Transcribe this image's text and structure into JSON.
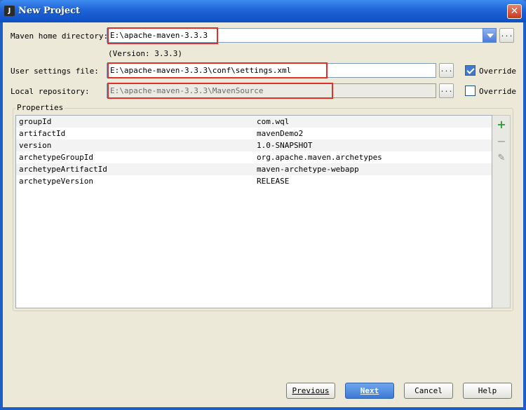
{
  "window": {
    "title": "New Project",
    "app_icon_text": "J"
  },
  "form": {
    "maven_home_label": "Maven home directory:",
    "maven_home_value": "E:\\apache-maven-3.3.3",
    "version_text": "(Version: 3.3.3)",
    "user_settings_label": "User settings file:",
    "user_settings_value": "E:\\apache-maven-3.3.3\\conf\\settings.xml",
    "user_settings_override_label": "Override",
    "user_settings_override_checked": true,
    "local_repo_label": "Local repository:",
    "local_repo_value": "E:\\apache-maven-3.3.3\\MavenSource",
    "local_repo_override_label": "Override",
    "local_repo_override_checked": false,
    "browse_label": "..."
  },
  "properties": {
    "title": "Properties",
    "rows": [
      {
        "key": "groupId",
        "value": "com.wql"
      },
      {
        "key": "artifactId",
        "value": "mavenDemo2"
      },
      {
        "key": "version",
        "value": "1.0-SNAPSHOT"
      },
      {
        "key": "archetypeGroupId",
        "value": "org.apache.maven.archetypes"
      },
      {
        "key": "archetypeArtifactId",
        "value": "maven-archetype-webapp"
      },
      {
        "key": "archetypeVersion",
        "value": "RELEASE"
      }
    ],
    "tools": {
      "add": "+",
      "remove": "−",
      "edit": "✎"
    }
  },
  "buttons": {
    "previous": "Previous",
    "next": "Next",
    "cancel": "Cancel",
    "help": "Help"
  },
  "colors": {
    "title_bar": "#1f63d6",
    "highlight_box": "#e0302a",
    "add_icon": "#2e9e3a"
  }
}
